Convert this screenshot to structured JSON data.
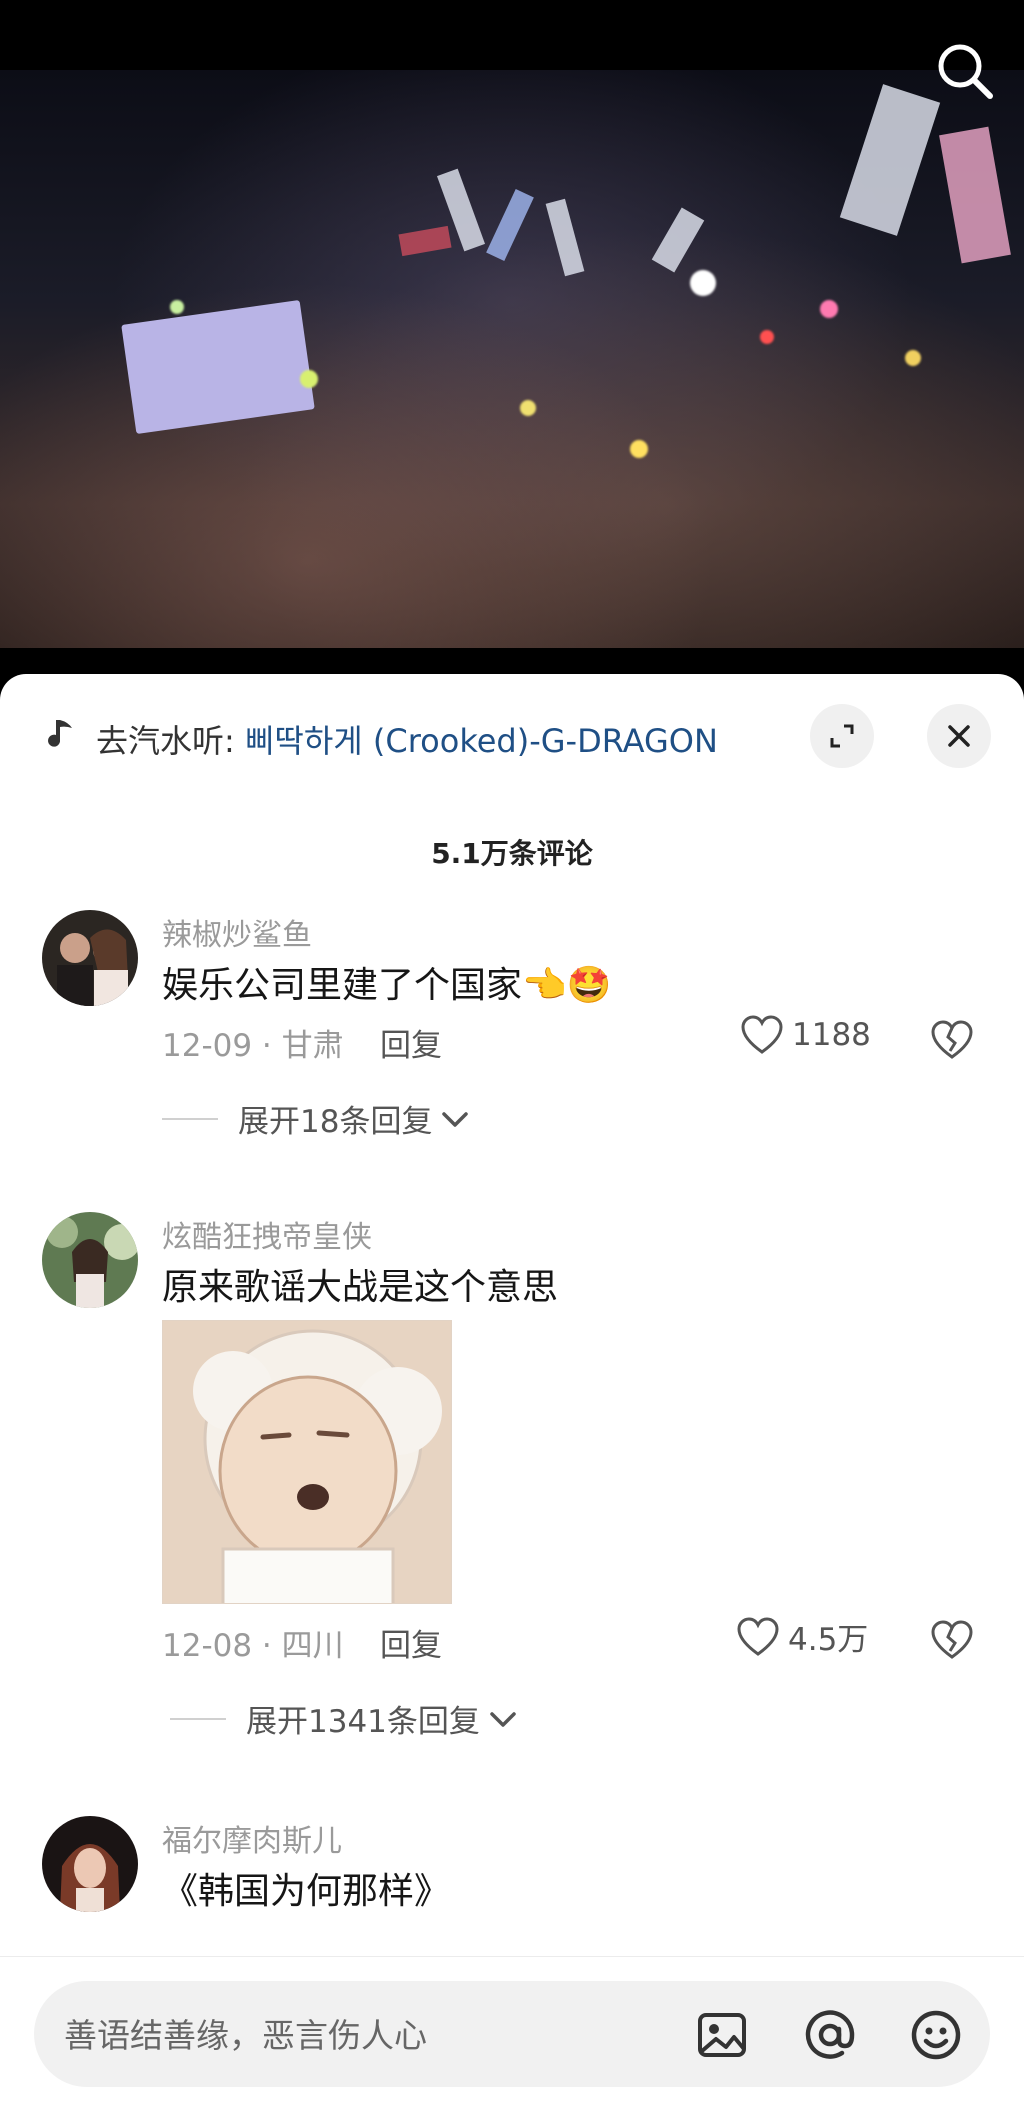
{
  "music": {
    "prefix": "去汽水听: ",
    "song": "삐딱하게 (Crooked)-G-DRAGON"
  },
  "comments_header": {
    "count_label": "5.1万条评论"
  },
  "comments": [
    {
      "username": "辣椒炒鲨鱼",
      "text": "娱乐公司里建了个国家",
      "emojis": [
        "👈",
        "🤩"
      ],
      "date_location": "12-09 · 甘肃",
      "reply_label": "回复",
      "likes": "1188",
      "expand_label": "展开18条回复"
    },
    {
      "username": "炫酷狂拽帝皇侠",
      "text": "原来歌谣大战是这个意思",
      "date_location": "12-08 · 四川",
      "reply_label": "回复",
      "likes": "4.5万",
      "expand_label": "展开1341条回复"
    },
    {
      "username": "福尔摩肉斯儿",
      "text": "《韩国为何那样》"
    }
  ],
  "input": {
    "placeholder": "善语结善缘，恶言伤人心"
  },
  "colors": {
    "song_link": "#1f4f85",
    "meta_gray": "#9a9a9a",
    "sheet_bg": "#ffffff"
  },
  "icons": [
    "search-icon",
    "music-note-icon",
    "expand-screen-icon",
    "close-icon",
    "heart-icon",
    "dislike-heart-icon",
    "chevron-down-icon",
    "image-icon",
    "at-icon",
    "emoji-icon"
  ]
}
